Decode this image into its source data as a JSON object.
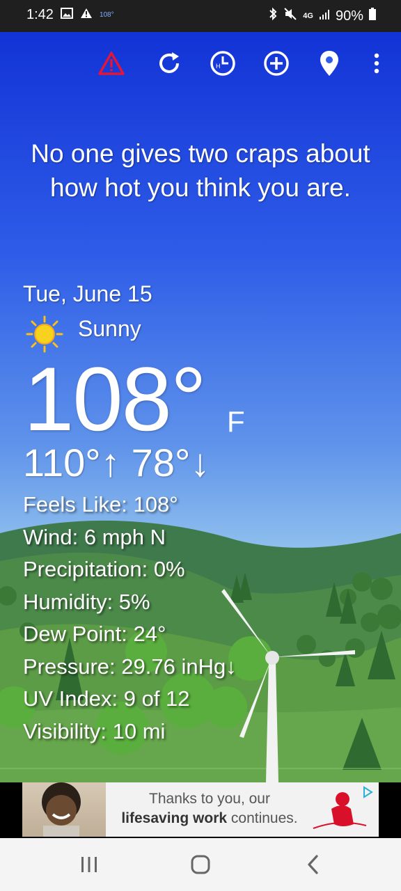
{
  "status_bar": {
    "time": "1:42",
    "notif_temp": "108°",
    "network": "4G",
    "battery": "90%"
  },
  "toolbar": {
    "icons": [
      "alert-icon",
      "refresh-icon",
      "history-clock-icon",
      "add-location-icon",
      "location-pin-icon",
      "more-vert-icon"
    ],
    "alert_color": "#e0163a"
  },
  "quote": "No one gives two craps about how hot you think you are.",
  "weather": {
    "date": "Tue, June 15",
    "condition": "Sunny",
    "condition_icon": "sun-icon",
    "temperature": "108°",
    "unit": "F",
    "high": "110°↑",
    "low": "78°↓",
    "details": [
      "Feels Like: 108°",
      "Wind: 6 mph N",
      "Precipitation: 0%",
      "Humidity: 5%",
      "Dew Point: 24°",
      "Pressure: 29.76 inHg↓",
      "UV Index: 9 of 12",
      "Visibility: 10 mi"
    ]
  },
  "ad": {
    "line1": "Thanks to you, our",
    "line2_bold": "lifesaving work",
    "line2_rest": " continues.",
    "brand_color": "#d8102a"
  },
  "nav": {
    "icons": [
      "recent-apps-icon",
      "home-icon",
      "back-icon"
    ]
  }
}
